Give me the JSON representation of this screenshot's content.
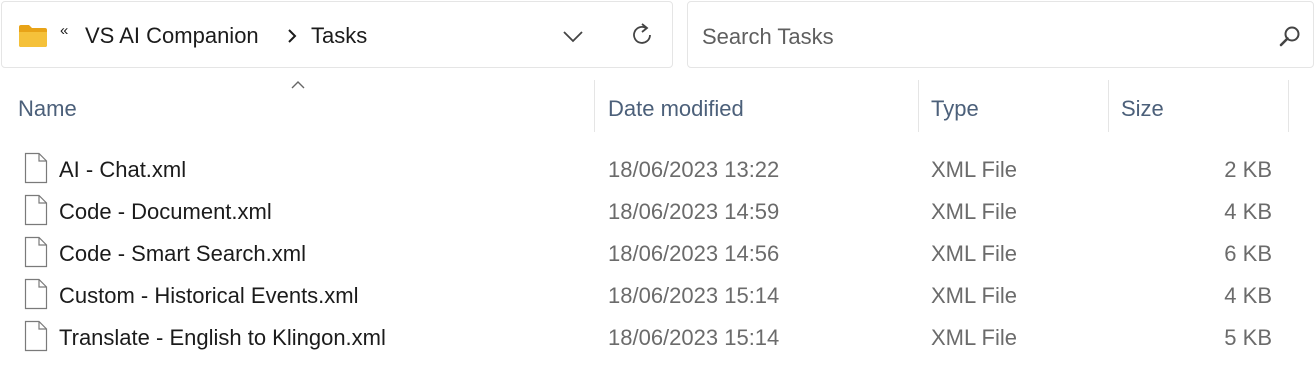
{
  "address": {
    "overflow_glyph": "«",
    "breadcrumbs": [
      "VS AI Companion",
      "Tasks"
    ]
  },
  "search": {
    "placeholder": "Search Tasks",
    "value": ""
  },
  "columns": {
    "name": "Name",
    "date": "Date modified",
    "type": "Type",
    "size": "Size"
  },
  "sort": {
    "column": "Name",
    "direction": "ascending"
  },
  "files": [
    {
      "name": "AI - Chat.xml",
      "date": "18/06/2023 13:22",
      "type": "XML File",
      "size": "2 KB"
    },
    {
      "name": "Code - Document.xml",
      "date": "18/06/2023 14:59",
      "type": "XML File",
      "size": "4 KB"
    },
    {
      "name": "Code - Smart Search.xml",
      "date": "18/06/2023 14:56",
      "type": "XML File",
      "size": "6 KB"
    },
    {
      "name": "Custom - Historical Events.xml",
      "date": "18/06/2023 15:14",
      "type": "XML File",
      "size": "4 KB"
    },
    {
      "name": "Translate - English to Klingon.xml",
      "date": "18/06/2023 15:14",
      "type": "XML File",
      "size": "5 KB"
    }
  ],
  "colors": {
    "folder": "#f5c13a",
    "header_text": "#4c607a",
    "secondary_text": "#6b6b6b",
    "border": "#e5e5e5"
  },
  "icons": {
    "folder": "folder-icon",
    "file": "file-icon",
    "dropdown": "chevron-down-icon",
    "refresh": "refresh-icon",
    "search": "search-icon"
  }
}
